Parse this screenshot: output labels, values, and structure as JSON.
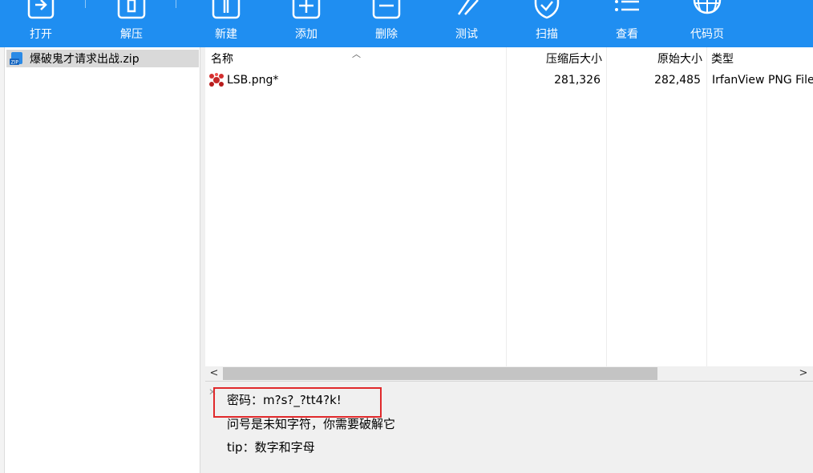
{
  "toolbar": {
    "buttons": [
      {
        "label": "打开",
        "icon": "open-icon"
      },
      {
        "label": "解压",
        "icon": "extract-icon"
      },
      {
        "label": "新建",
        "icon": "new-icon"
      },
      {
        "label": "添加",
        "icon": "add-icon"
      },
      {
        "label": "删除",
        "icon": "delete-icon"
      },
      {
        "label": "测试",
        "icon": "test-icon"
      },
      {
        "label": "扫描",
        "icon": "scan-icon"
      },
      {
        "label": "查看",
        "icon": "view-icon"
      },
      {
        "label": "代码页",
        "icon": "codepage-icon"
      }
    ],
    "background": "#1f8ef1"
  },
  "tree": {
    "items": [
      {
        "label": "爆破鬼才请求出战.zip",
        "icon": "zip-archive-icon"
      }
    ]
  },
  "file_list": {
    "columns": {
      "name": "名称",
      "compressed": "压缩后大小",
      "original": "原始大小",
      "type": "类型"
    },
    "rows": [
      {
        "name": "LSB.png*",
        "compressed": "281,326",
        "original": "282,485",
        "type": "IrfanView PNG File",
        "icon": "irfanview-file-icon"
      }
    ]
  },
  "comment": {
    "lines": [
      "密码：m?s?_?tt4?k!",
      "问号是未知字符，你需要破解它",
      "tip：数字和字母"
    ],
    "highlight_color": "#e0292b"
  }
}
